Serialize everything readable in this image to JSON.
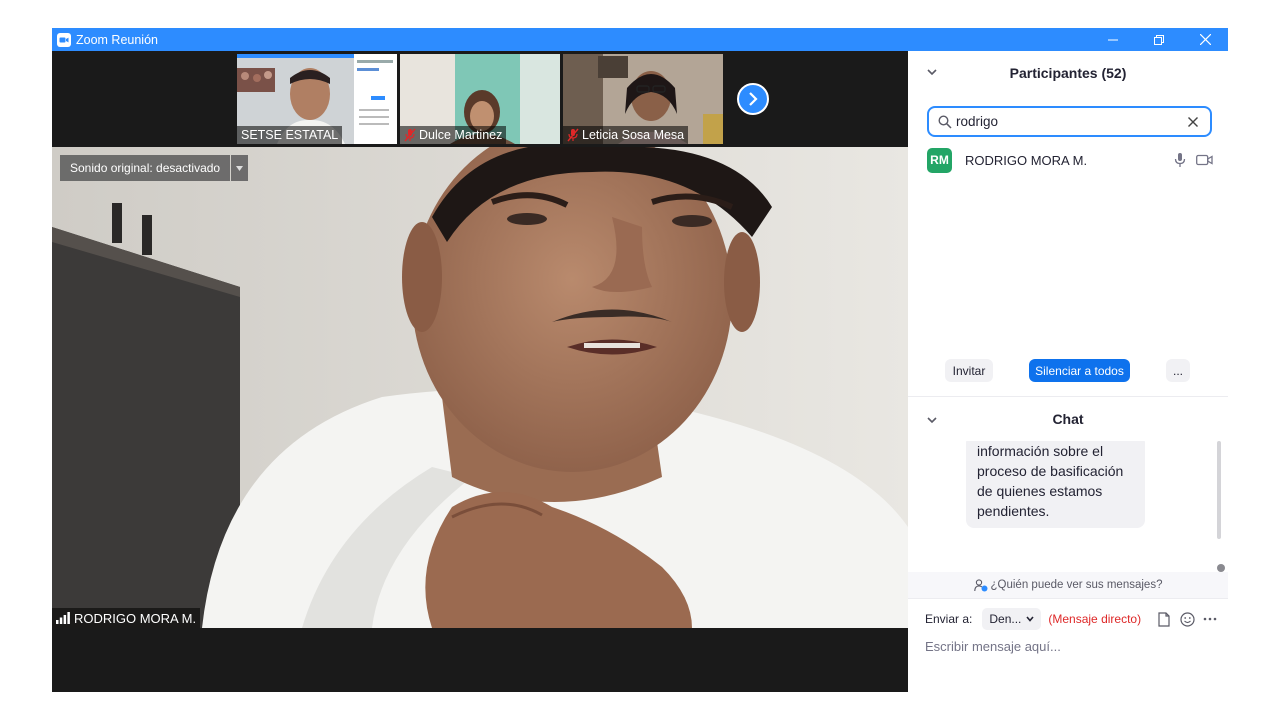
{
  "window": {
    "title": "Zoom Reunión",
    "controls": {
      "minimize": "minimize-icon",
      "restore": "restore-icon",
      "close": "close-icon"
    }
  },
  "thumbnails": [
    {
      "name": "SETSE ESTATAL",
      "muted": false
    },
    {
      "name": "Dulce Martinez",
      "muted": true
    },
    {
      "name": "Leticia Sosa Mesa",
      "muted": true
    }
  ],
  "main_video": {
    "sound_button": "Sonido original: desactivado",
    "speaker_name": "RODRIGO MORA M."
  },
  "participants_panel": {
    "title": "Participantes (52)",
    "search_value": "rodrigo",
    "participants": [
      {
        "initials": "RM",
        "name": "RODRIGO MORA M.",
        "avatar_color": "#23a566"
      }
    ],
    "actions": {
      "invite": "Invitar",
      "mute_all": "Silenciar a todos",
      "more": "..."
    }
  },
  "chat_panel": {
    "title": "Chat",
    "message_text": "información sobre el proceso de basificación de quienes estamos pendientes.",
    "who_can_see": "¿Quién puede ver sus mensajes?",
    "send_to_label": "Enviar a:",
    "recipient": "Den...",
    "direct_message_tag": "(Mensaje directo)",
    "input_placeholder": "Escribir mensaje aquí..."
  },
  "colors": {
    "zoom_blue": "#2d8cff",
    "primary_button": "#0e72ed",
    "direct_red": "#de2828"
  }
}
